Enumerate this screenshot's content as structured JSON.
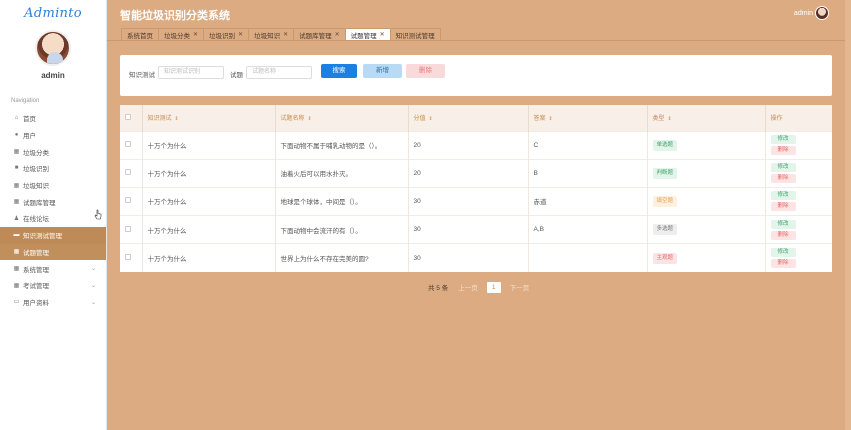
{
  "app": {
    "logo": "Adminto",
    "title": "智能垃圾识别分类系统",
    "user": "admin"
  },
  "sidebar": {
    "username": "admin",
    "caption": "Navigation",
    "items": [
      {
        "label": "首页",
        "icon": "home-icon"
      },
      {
        "label": "用户",
        "icon": "user-pin-icon"
      },
      {
        "label": "垃圾分类",
        "icon": "grid-icon"
      },
      {
        "label": "垃圾识别",
        "icon": "camera-icon"
      },
      {
        "label": "垃圾知识",
        "icon": "grid-icon"
      },
      {
        "label": "试题库管理",
        "icon": "grid-icon"
      },
      {
        "label": "在线论坛",
        "icon": "person-icon"
      },
      {
        "label": "知识测试管理",
        "icon": "briefcase-icon"
      },
      {
        "label": "试题管理",
        "icon": "grid-icon"
      },
      {
        "label": "系统管理",
        "icon": "grid-icon"
      },
      {
        "label": "考试管理",
        "icon": "grid-icon"
      },
      {
        "label": "用户资料",
        "icon": "document-icon"
      }
    ]
  },
  "tabs": [
    {
      "label": "系统首页"
    },
    {
      "label": "垃圾分类"
    },
    {
      "label": "垃圾识别"
    },
    {
      "label": "垃圾知识"
    },
    {
      "label": "试题库管理"
    },
    {
      "label": "试题管理"
    },
    {
      "label": "知识测试管理"
    }
  ],
  "search": {
    "label_test": "知识测试",
    "placeholder_test": "知识测试识别",
    "label_question": "试题",
    "placeholder_question": "试题名称",
    "btn_search": "搜索",
    "btn_add": "新增",
    "btn_delete": "删除"
  },
  "table": {
    "headers": [
      "知识测试",
      "试题名称",
      "分值",
      "答案",
      "类型",
      "操作"
    ],
    "rows": [
      {
        "test": "十万个为什么",
        "question": "下面动物不属于哺乳动物的是（）。",
        "score": "20",
        "answer": "C",
        "type": "单选题",
        "type_class": "tag-single"
      },
      {
        "test": "十万个为什么",
        "question": "油着火后可以用水扑灭。",
        "score": "20",
        "answer": "B",
        "type": "判断题",
        "type_class": "tag-judge"
      },
      {
        "test": "十万个为什么",
        "question": "地球是个球体，中间是（）。",
        "score": "30",
        "answer": "赤道",
        "type": "填空题",
        "type_class": "tag-fill"
      },
      {
        "test": "十万个为什么",
        "question": "下面动物中会流汗的有（）。",
        "score": "30",
        "answer": "A,B",
        "type": "多选题",
        "type_class": "tag-multi"
      },
      {
        "test": "十万个为什么",
        "question": "世界上为什么不存在完美的圆?",
        "score": "30",
        "answer": "",
        "type": "主观题",
        "type_class": "tag-subj"
      }
    ],
    "op_edit": "修改",
    "op_delete": "删除"
  },
  "pager": {
    "total": "共 5 条",
    "prev": "上一页",
    "page": "1",
    "next": "下一页"
  },
  "colors": {
    "background": "#dcab82",
    "sidebar_active": "#be8a57",
    "primary_button": "#1e7fe3"
  }
}
